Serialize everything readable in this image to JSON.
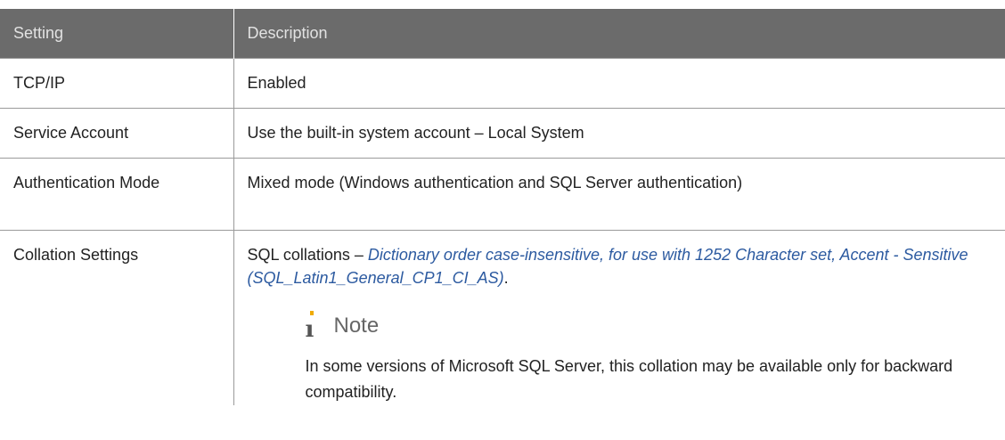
{
  "table": {
    "headers": {
      "setting": "Setting",
      "description": "Description"
    },
    "rows": {
      "tcp": {
        "setting": "TCP/IP",
        "description": "Enabled"
      },
      "svc": {
        "setting": "Service Account",
        "description": "Use the built-in system account – Local System"
      },
      "auth": {
        "setting": "Authentication Mode",
        "description": "Mixed mode (Windows authentication and SQL Server authentication)"
      },
      "coll": {
        "setting": "Collation Settings",
        "description_prefix": "SQL collations – ",
        "description_italic": "Dictionary order case-insensitive, for use with 1252 Character set, Accent - Sensitive (SQL_Latin1_General_CP1_CI_AS)",
        "description_suffix": ".",
        "note_title": "Note",
        "note_text": "In some versions of Microsoft SQL Server, this collation may be available only for backward compatibility."
      }
    }
  },
  "colors": {
    "header_bg": "#6b6b6b",
    "header_text": "#e2e2e2",
    "italic_link": "#2c5aa0",
    "note_icon_dot": "#f0ab00"
  },
  "icons": {
    "note": "info-i-icon"
  }
}
